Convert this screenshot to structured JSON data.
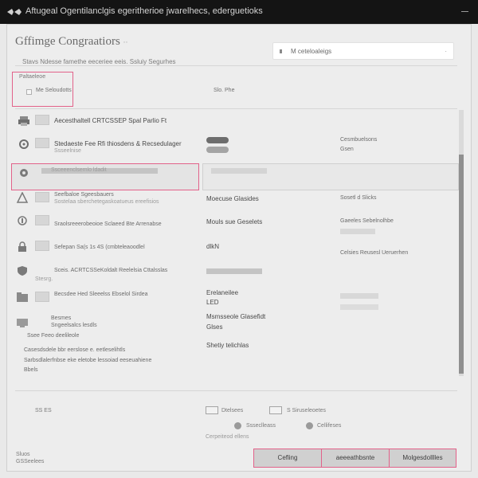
{
  "window": {
    "title": "Aftugeal Ogentilanclgis egeritherioe jwarelhecs, ederguetioks"
  },
  "header": {
    "title": "Gffimge Congraatiors",
    "title_suffix": "··",
    "subtitle": "Stavs Ndesse famethe eeceriee eeis. Ssluiy Segurhes"
  },
  "search": {
    "placeholder": "M ceteloaleigs",
    "caret": "·"
  },
  "filter": {
    "label": "Paltaeleoe",
    "checkbox_label": "Me Seloudotts",
    "column_label": "Slo. Phe"
  },
  "rows": [
    {
      "icon": "printer-icon",
      "title": "Aecesthaltell CRTCSSEP Spal Parlio Ft",
      "mid": "",
      "right": ""
    },
    {
      "icon": "settings-icon",
      "title": "Stedaeste Fee Rfi thiosdens & Recsedulager",
      "subtitle": "Ssseelnise",
      "pills": [
        "dark",
        "light"
      ],
      "right": "Cesmbuelsons",
      "right2": "Gsen"
    },
    {
      "icon": "gear-icon",
      "title": "Ssceeenclsemlo ldadit",
      "selected": true
    },
    {
      "icon": "users-icon",
      "title": "Seefbaloe Sgeesbauers",
      "subtitle": "Sostelaa sberchetegaskoatueus ereefisios",
      "mid": "Moecuse Glasides",
      "right": "Sosetl d Slicks"
    },
    {
      "icon": "key-icon",
      "title": "Sraolsreeerobeoioe Sclaeed Bte Arrenabse",
      "mid": "Mouls sue Geselets",
      "right": "Gaeeles Sebelnolhbe"
    },
    {
      "icon": "lock-icon",
      "title": "Sefepan Sa(s 1s 4S (cmbteleaoodlel",
      "mid": "dlkN",
      "right": "Celsies Reusesl Ueruerhen"
    },
    {
      "icon": "shield-icon",
      "title": "Sceis. ACRTCSSeKoldalt Reelelsia Cttalsslas",
      "subtitle": "Stesrg.",
      "mid": ""
    },
    {
      "icon": "folder-icon",
      "title": "Becsdee Hed Sleeelss Ebselol Sirdea",
      "mid": "Erelaneilee",
      "mid2": "LED"
    },
    {
      "icon": "monitor-icon",
      "title": "Besmes",
      "subtitle": "Sngeelsalcs lesdls",
      "mid": "Msmsseole Glasefidt",
      "mid2": "Glses"
    },
    {
      "icon": "",
      "title": "Ssee Feeo deelileole",
      "mid": "Shetiy telichlas"
    }
  ],
  "notes": {
    "line1": "Casesdsdele bbr eerslose e. eetleselihtls",
    "line2": "Sarbsdlalerfnbse eke eletobe lessoiad eeseuahiene",
    "line3": "Bbels"
  },
  "footer": {
    "left": "SS ES",
    "opt1": "Dtelsees",
    "opt2": "S Siruseleoetes",
    "opt3": "Ssseclleass",
    "opt4": "Cellifeses",
    "opt5": "Cerpeiteod ellens"
  },
  "bottom": {
    "line1": "Sluos",
    "line2": "GSSeelees"
  },
  "buttons": {
    "cancel": "Cefling",
    "apply": "aeeeathbsnte",
    "save": "Molgesdolllles"
  },
  "colors": {
    "accent": "#e2628a",
    "titlebar": "#141414",
    "background": "#ededed"
  }
}
